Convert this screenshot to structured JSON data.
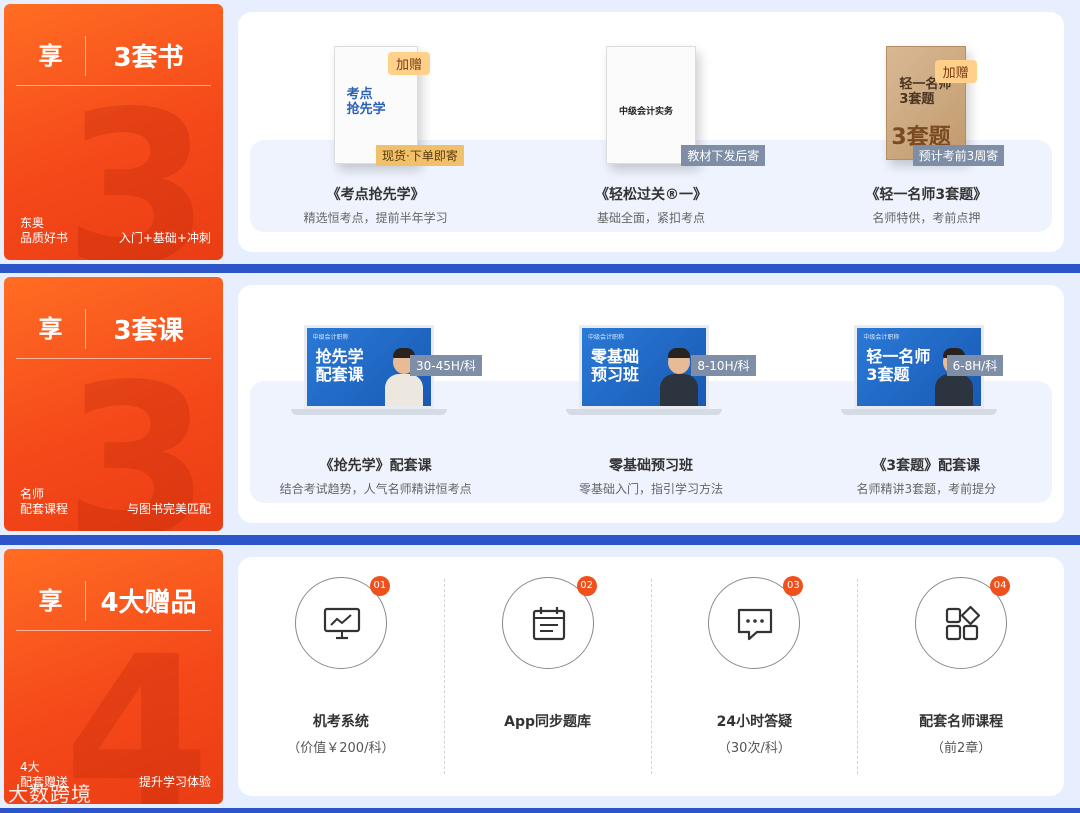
{
  "sections": [
    {
      "enjoy": "享",
      "sub": "3套书",
      "big": "3",
      "note_left": [
        "东奥",
        "品质好书"
      ],
      "note_right": "入门+基础+冲刺",
      "items": [
        {
          "gift_tag": "加赠",
          "cover_title": [
            "考点",
            "抢先学"
          ],
          "note": "现货·下单即寄",
          "title": "《考点抢先学》",
          "desc": "精选恒考点，提前半年学习"
        },
        {
          "gift_tag": "",
          "cover_title": [
            "中级会计实务"
          ],
          "note": "教材下发后寄",
          "title": "《轻松过关®一》",
          "desc": "基础全面，紧扣考点"
        },
        {
          "gift_tag": "加赠",
          "cover_title": [
            "轻一名师",
            "3套题"
          ],
          "cover_big": "3套题",
          "note": "预计考前3周寄",
          "title": "《轻一名师3套题》",
          "desc": "名师特供，考前点押"
        }
      ]
    },
    {
      "enjoy": "享",
      "sub": "3套课",
      "big": "3",
      "note_left": [
        "名师",
        "配套课程"
      ],
      "note_right": "与图书完美匹配",
      "items": [
        {
          "brand": "中级会计职称",
          "screen": [
            "抢先学",
            "配套课"
          ],
          "hours": "30-45H/科",
          "title": "《抢先学》配套课",
          "desc": "结合考试趋势，人气名师精讲恒考点"
        },
        {
          "brand": "中级会计职称",
          "screen": [
            "零基础",
            "预习班"
          ],
          "hours": "8-10H/科",
          "title": "零基础预习班",
          "desc": "零基础入门，指引学习方法"
        },
        {
          "brand": "中级会计职称",
          "screen": [
            "轻一名师",
            "3套题"
          ],
          "hours": "6-8H/科",
          "title": "《3套题》配套课",
          "desc": "名师精讲3套题，考前提分"
        }
      ]
    },
    {
      "enjoy": "享",
      "sub": "4大赠品",
      "big": "4",
      "note_left": [
        "4大",
        "配套赠送"
      ],
      "note_right": "提升学习体验",
      "gifts": [
        {
          "num": "01",
          "icon": "monitor-chart-icon",
          "title": "机考系统",
          "desc": "（价值￥200/科）"
        },
        {
          "num": "02",
          "icon": "calendar-icon",
          "title": "App同步题库",
          "desc": ""
        },
        {
          "num": "03",
          "icon": "chat-bubble-icon",
          "title": "24小时答疑",
          "desc": "（30次/科）"
        },
        {
          "num": "04",
          "icon": "apps-grid-icon",
          "title": "配套名师课程",
          "desc": "（前2章）"
        }
      ]
    }
  ],
  "watermark": "大数跨境"
}
